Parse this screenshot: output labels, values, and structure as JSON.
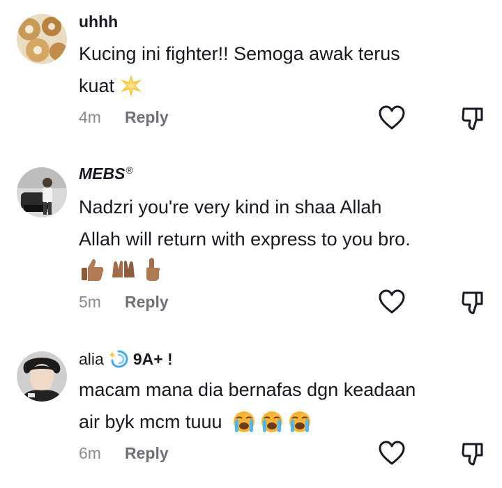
{
  "comments": [
    {
      "username": "uhhh",
      "text_line1": "Kucing ini fighter!! Semoga awak terus",
      "text_line2": "kuat",
      "emoji": "sparkle-star",
      "time": "4m",
      "reply_label": "Reply"
    },
    {
      "username": "MEBS",
      "username_suffix": "®",
      "text_line1": "Nadzri you're very kind in shaa Allah",
      "text_line2": "Allah will return with express to you bro.",
      "emojis": [
        "thumbs-up",
        "raised-hands",
        "index-pointing-up"
      ],
      "time": "5m",
      "reply_label": "Reply"
    },
    {
      "username": "alia",
      "username_suffix": "9A+ !",
      "text_line1": "macam mana dia bernafas dgn keadaan",
      "text_line2": "air byk mcm tuuu",
      "emojis": [
        "loudly-crying-face",
        "loudly-crying-face",
        "loudly-crying-face"
      ],
      "time": "6m",
      "reply_label": "Reply"
    }
  ],
  "colors": {
    "text": "#161823",
    "muted": "#8a8b91",
    "icon": "#161823"
  }
}
